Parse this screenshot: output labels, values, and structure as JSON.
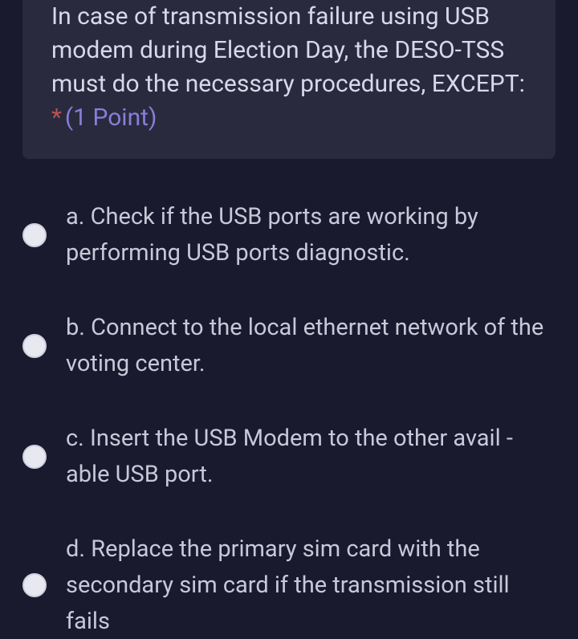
{
  "question": {
    "text": "In case of transmission failure using USB modem during Election Day, the DESO-TSS must do the necessary procedures, EXCEPT:",
    "required_mark": "*",
    "points_label": "(1 Point)"
  },
  "options": [
    {
      "label": "a. Check if the USB ports are working by performing USB ports diagnostic."
    },
    {
      "label": "b. Connect to the local ethernet network of the voting center."
    },
    {
      "label": "c. Insert the USB Modem to the other avail - able USB port."
    },
    {
      "label": "d. Replace the primary sim card with the secondary sim card if the transmission still fails"
    }
  ]
}
